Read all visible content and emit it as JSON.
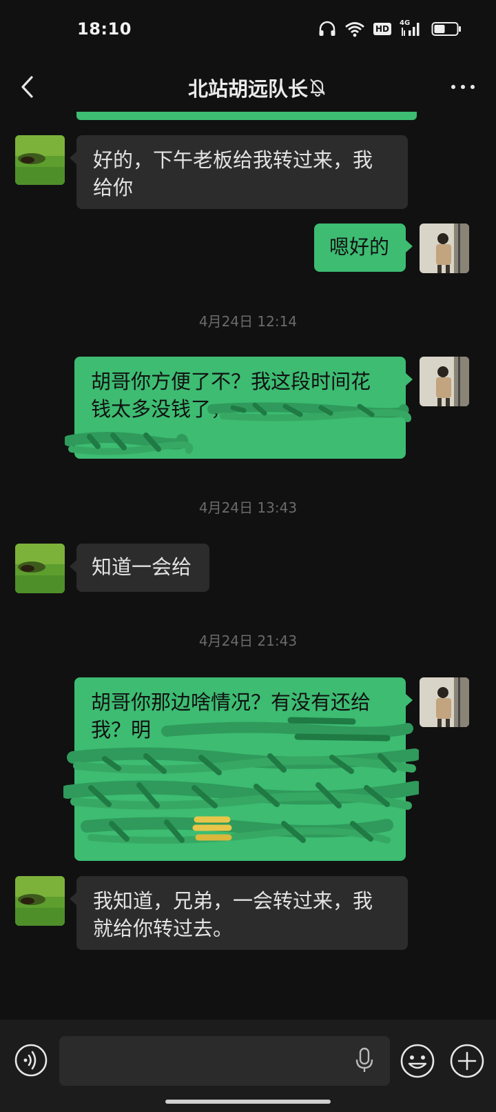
{
  "status_bar": {
    "time": "18:10",
    "icons": [
      "headphones-icon",
      "wifi-icon",
      "hd-icon",
      "4g-signal-icon",
      "battery-icon"
    ],
    "hd_label": "HD",
    "network_label": "4G"
  },
  "header": {
    "title": "北站胡远队长",
    "back_icon": "chevron-left-icon",
    "mute_icon": "bell-off-icon",
    "more_icon": "more-dots-icon"
  },
  "messages": [
    {
      "side": "in",
      "text": "好的，下午老板给我转过来，我给你"
    },
    {
      "side": "out",
      "text": "嗯好的"
    },
    {
      "type": "time",
      "text": "4月24日 12:14"
    },
    {
      "side": "out",
      "text": "胡哥你方便了不？我这段时间花钱太多没钱了，",
      "redacted": true
    },
    {
      "type": "time",
      "text": "4月24日 13:43"
    },
    {
      "side": "in",
      "text": "知道一会给"
    },
    {
      "type": "time",
      "text": "4月24日 21:43"
    },
    {
      "side": "out",
      "text": "胡哥你那边啥情况？有没有还给我？明",
      "redacted": true
    },
    {
      "side": "in",
      "text": "我知道，兄弟，一会转过来，我就给你转过去。"
    }
  ],
  "input_bar": {
    "voice_icon": "voice-icon",
    "mic_icon": "microphone-icon",
    "emoji_icon": "emoji-icon",
    "plus_icon": "plus-icon",
    "input_value": ""
  },
  "colors": {
    "background": "#111111",
    "bubble_out": "#3dbc72",
    "bubble_in": "#2c2c2c",
    "timestamp": "#6b6b6b"
  }
}
